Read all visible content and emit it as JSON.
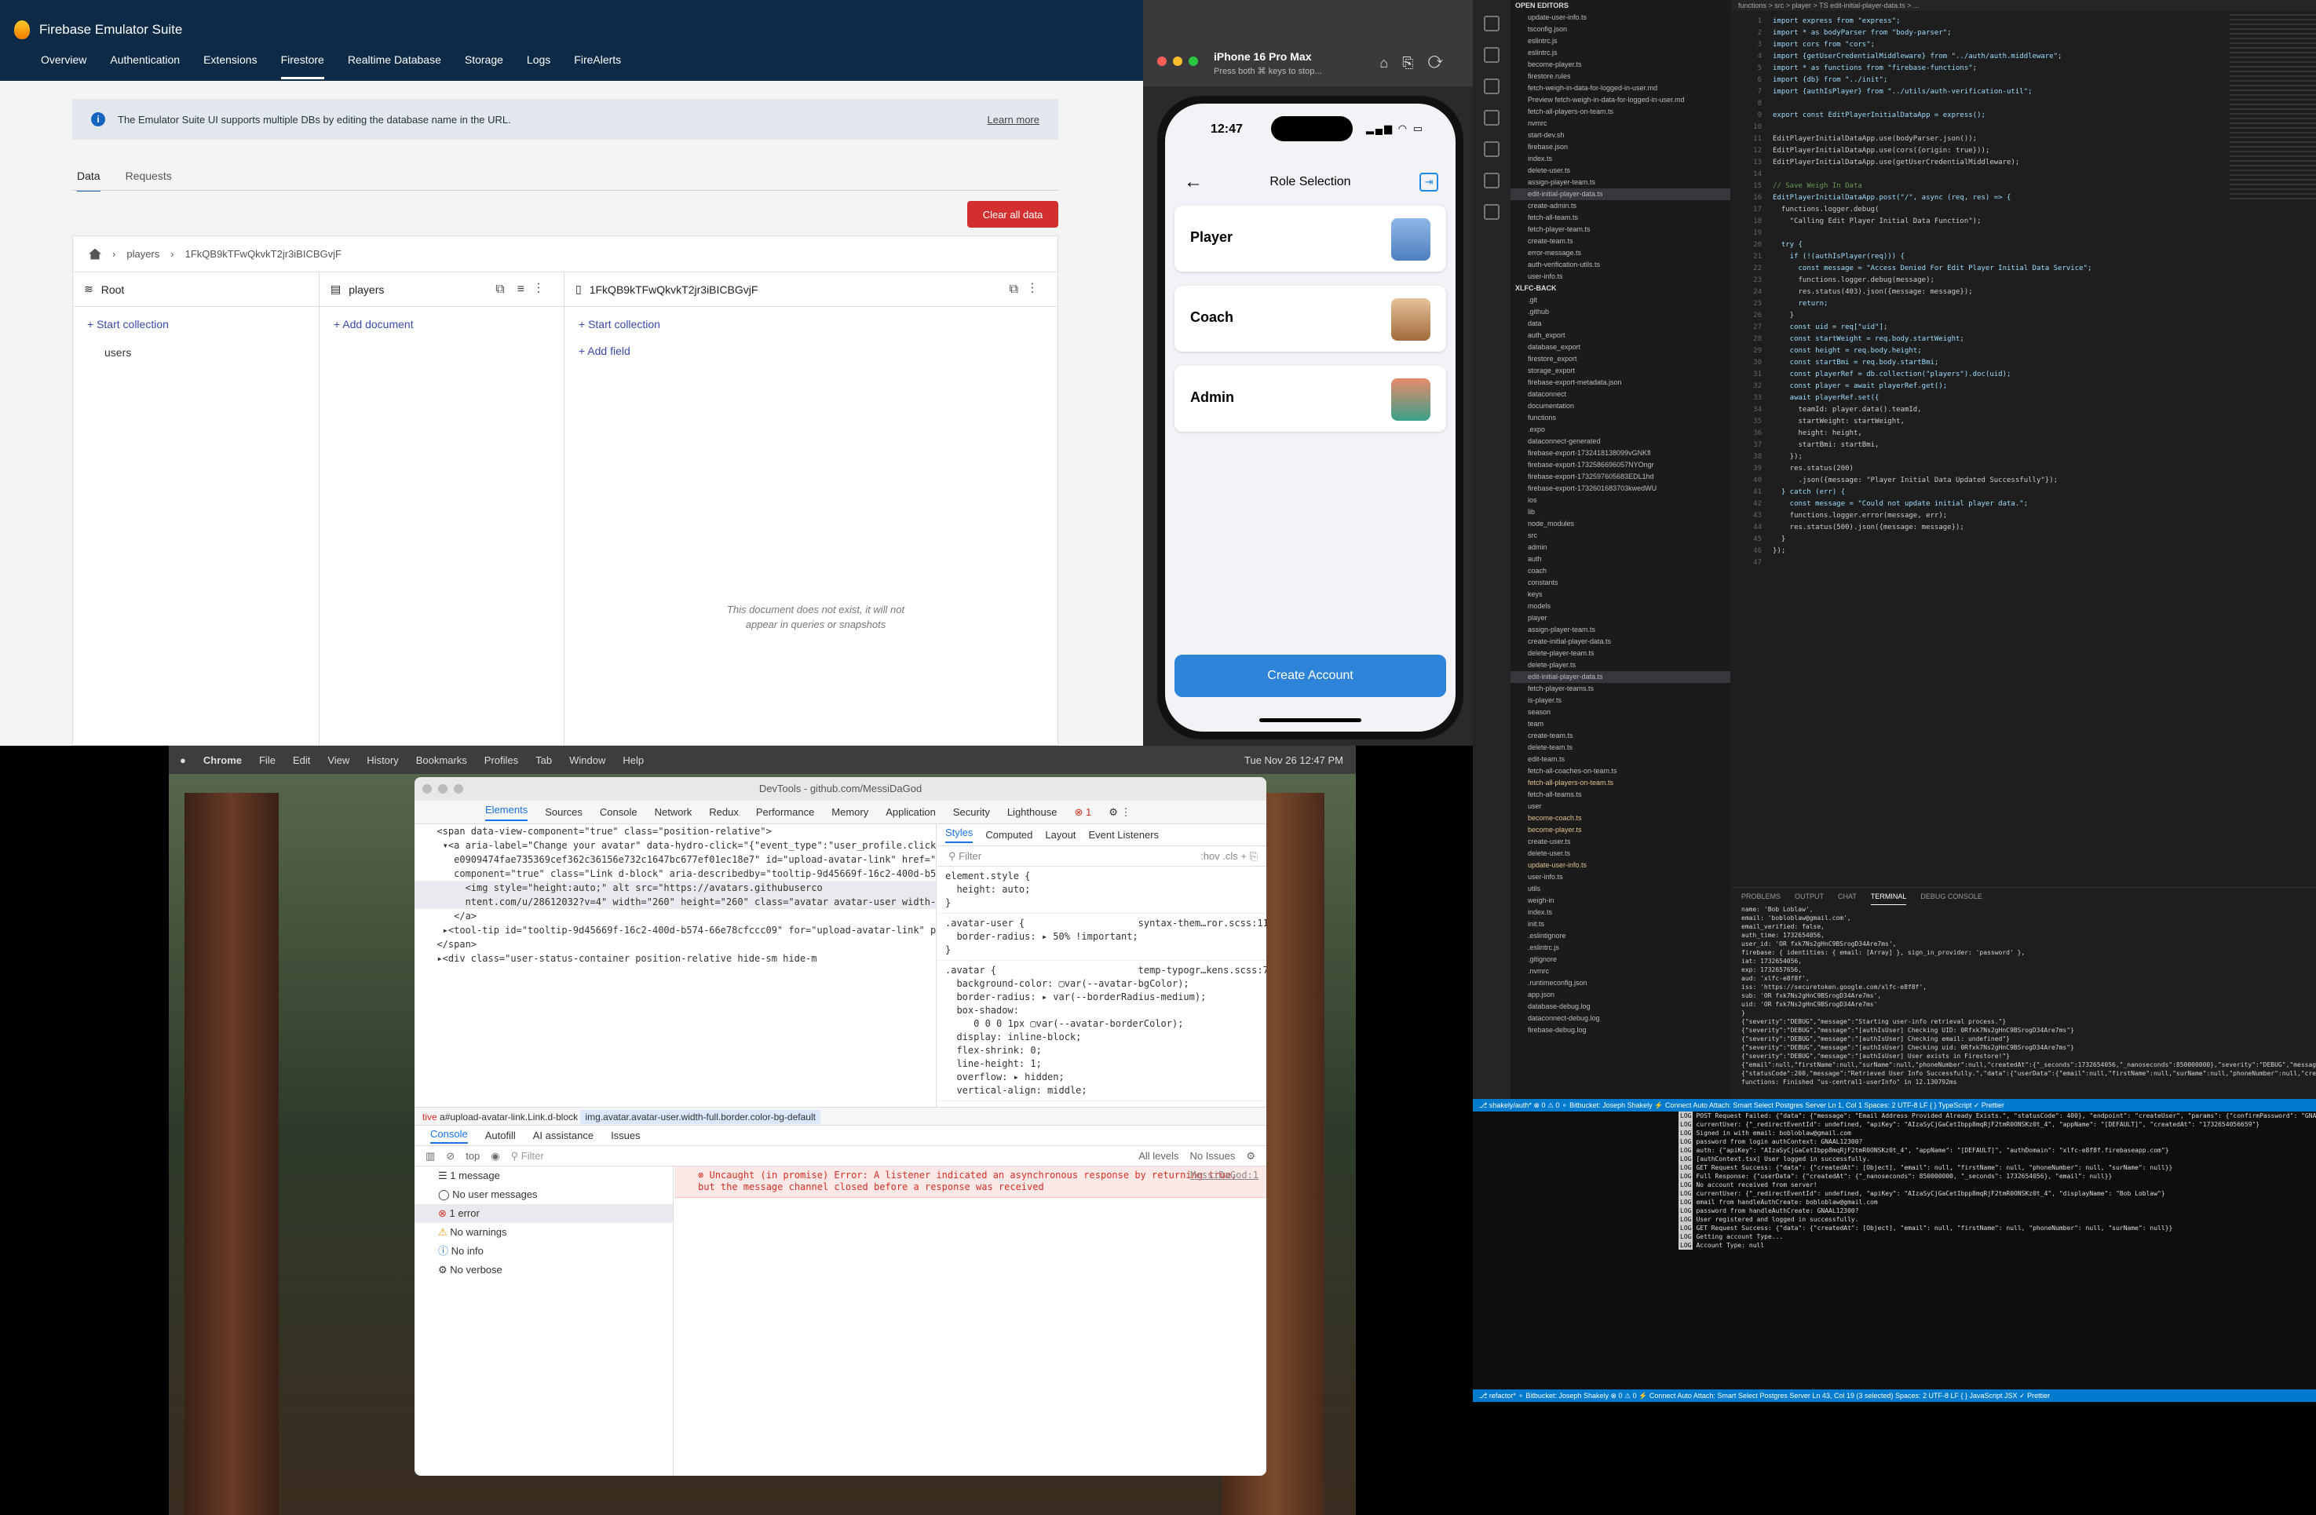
{
  "firebase": {
    "app_title": "Firebase Emulator Suite",
    "tabs": [
      "Overview",
      "Authentication",
      "Extensions",
      "Firestore",
      "Realtime Database",
      "Storage",
      "Logs",
      "FireAlerts"
    ],
    "info_text": "The Emulator Suite UI supports multiple DBs by editing the database name in the URL.",
    "learn_more": "Learn more",
    "subtabs": [
      "Data",
      "Requests"
    ],
    "clear_button": "Clear all data",
    "breadcrumb": [
      "players",
      "1FkQB9kTFwQkvkT2jr3iBICBGvjF"
    ],
    "col1_title": "Root",
    "col2_title": "players",
    "col3_title": "1FkQB9kTFwQkvkT2jr3iBICBGvjF",
    "start_collection": "Start collection",
    "add_document": "Add document",
    "add_field": "Add field",
    "root_item": "users",
    "missing_note": "This document does not exist, it will not appear in queries or snapshots"
  },
  "simulator": {
    "device": "iPhone 16 Pro Max",
    "hint": "Press both ⌘ keys to stop...",
    "time": "12:47",
    "screen_title": "Role Selection",
    "roles": [
      "Player",
      "Coach",
      "Admin"
    ],
    "create_button": "Create Account"
  },
  "vscode": {
    "tab_path": "functions > src > player > TS edit-initial-player-data.ts > ...",
    "open_editors_title": "OPEN EDITORS",
    "open_editors": [
      "update-user-info.ts",
      "tsconfig.json",
      "eslintrc.js",
      "eslintrc.js",
      "become-player.ts",
      "firestore.rules",
      "fetch-weigh-in-data-for-logged-in-user.md",
      "Preview fetch-weigh-in-data-for-logged-in-user.md",
      "fetch-all-players-on-team.ts",
      "nvmrc",
      "start-dev.sh",
      "firebase.json",
      "index.ts",
      "delete-user.ts",
      "assign-player-team.ts",
      "edit-initial-player-data.ts",
      "create-admin.ts",
      "fetch-all-team.ts",
      "fetch-player-team.ts",
      "create-team.ts",
      "error-message.ts",
      "auth-verification-utils.ts",
      "user-info.ts"
    ],
    "project_title": "XLFC-BACK",
    "tree": [
      ".git",
      ".github",
      "data",
      "auth_export",
      "database_export",
      "firestore_export",
      "storage_export",
      "firebase-export-metadata.json",
      "dataconnect",
      "documentation",
      "functions",
      ".expo",
      "dataconnect-generated",
      "firebase-export-1732418138099vGNKfl",
      "firebase-export-1732586696057NYOngr",
      "firebase-export-1732597605683EDL1hd",
      "firebase-export-1732601683703kwedWU",
      "ios",
      "lib",
      "node_modules",
      "src",
      "admin",
      "auth",
      "coach",
      "constants",
      "keys",
      "models",
      "player",
      "assign-player-team.ts",
      "create-initial-player-data.ts",
      "delete-player-team.ts",
      "delete-player.ts",
      "edit-initial-player-data.ts",
      "fetch-player-teams.ts",
      "is-player.ts",
      "season",
      "team",
      "create-team.ts",
      "delete-team.ts",
      "edit-team.ts",
      "fetch-all-coaches-on-team.ts",
      "fetch-all-players-on-team.ts",
      "fetch-all-teams.ts",
      "user",
      "become-coach.ts",
      "become-player.ts",
      "create-user.ts",
      "delete-user.ts",
      "update-user-info.ts",
      "user-info.ts",
      "utils",
      "weigh-in",
      "index.ts",
      "init.ts",
      ".eslintignore",
      ".eslintrc.js",
      ".gitignore",
      ".nvmrc",
      ".runtimeconfig.json",
      "app.json",
      "database-debug.log",
      "dataconnect-debug.log",
      "firebase-debug.log"
    ],
    "code_lines": [
      "import express from \"express\";",
      "import * as bodyParser from \"body-parser\";",
      "import cors from \"cors\";",
      "import {getUserCredentialMiddleware} from \"../auth/auth.middleware\";",
      "import * as functions from \"firebase-functions\";",
      "import {db} from \"../init\";",
      "import {authIsPlayer} from \"../utils/auth-verification-util\";",
      "",
      "export const EditPlayerInitialDataApp = express();",
      "",
      "EditPlayerInitialDataApp.use(bodyParser.json());",
      "EditPlayerInitialDataApp.use(cors({origin: true}));",
      "EditPlayerInitialDataApp.use(getUserCredentialMiddleware);",
      "",
      "// Save Weigh In Data",
      "EditPlayerInitialDataApp.post(\"/\", async (req, res) => {",
      "  functions.logger.debug(",
      "    \"Calling Edit Player Initial Data Function\");",
      "",
      "  try {",
      "    if (!(authIsPlayer(req))) {",
      "      const message = \"Access Denied For Edit Player Initial Data Service\";",
      "      functions.logger.debug(message);",
      "      res.status(403).json({message: message});",
      "      return;",
      "    }",
      "    const uid = req[\"uid\"];",
      "    const startWeight = req.body.startWeight;",
      "    const height = req.body.height;",
      "    const startBmi = req.body.startBmi;",
      "    const playerRef = db.collection(\"players\").doc(uid);",
      "    const player = await playerRef.get();",
      "    await playerRef.set({",
      "      teamId: player.data().teamId,",
      "      startWeight: startWeight,",
      "      height: height,",
      "      startBmi: startBmi,",
      "    });",
      "    res.status(200)",
      "      .json({message: \"Player Initial Data Updated Successfully\"});",
      "  } catch (err) {",
      "    const message = \"Could not update initial player data.\";",
      "    functions.logger.error(message, err);",
      "    res.status(500).json({message: message});",
      "  }",
      "});",
      ""
    ],
    "terminal_tabs": [
      "PROBLEMS",
      "OUTPUT",
      "CHAT",
      "TERMINAL",
      "DEBUG CONSOLE"
    ],
    "terminal_lines": [
      "name: 'Bob Loblaw',",
      "email: 'bobloblaw@gmail.com',",
      "email_verified: false,",
      "auth_time: 1732654056,",
      "user_id: 'OR fxk7Ns2gHnC9BSrogD34Are7ms',",
      "firebase: { identities: { email: [Array] }, sign_in_provider: 'password' },",
      "iat: 1732654056,",
      "exp: 1732657656,",
      "aud: 'xlfc-e8f8f',",
      "iss: 'https://securetoken.google.com/xlfc-e8f8f',",
      "sub: 'OR fxk7Ns2gHnC9BSrogD34Are7ms',",
      "uid: 'OR fxk7Ns2gHnC9BSrogD34Are7ms'",
      "}",
      "{\"severity\":\"DEBUG\",\"message\":\"Starting user-info retrieval process.\"}",
      "{\"severity\":\"DEBUG\",\"message\":\"[authIsUser] Checking UID: 0Rfxk7Ns2gHnC9BSrogD34Are7ms\"}",
      "{\"severity\":\"DEBUG\",\"message\":\"[authIsUser] Checking email: undefined\"}",
      "{\"severity\":\"DEBUG\",\"message\":\"[authIsUser] Checking uid: 0Rfxk7Ns2gHnC9BSrogD34Are7ms\"}",
      "{\"severity\":\"DEBUG\",\"message\":\"[authIsUser] User exists in Firestore!\"}",
      "{\"email\":null,\"firstName\":null,\"surName\":null,\"phoneNumber\":null,\"createdAt\":{\"_seconds\":1732654056,\"_nanoseconds\":850000000},\"severity\":\"DEBUG\",\"message\":\"[authIsUser] User exists in Firestore!\"}",
      "{\"statusCode\":200,\"message\":\"Retrieved User Info Successfully.\",\"data\":{\"userData\":{\"email\":null,\"firstName\":null,\"surName\":null,\"phoneNumber\":null,\"createdAt\":{\"_seconds\":1732654056,\"_nanoseconds\":850000000}}},\"severity\":\"INFO\"}",
      "functions: Finished \"us-central1-userInfo\" in 12.130792ms"
    ],
    "status_text": "⎇ shakely/auth*  ⊗ 0 ⚠ 0  ⚬ Bitbucket: Joseph Shakely  ⚡ Connect  Auto Attach: Smart  Select Postgres Server    Ln 1, Col 1  Spaces: 2  UTF-8  LF  { } TypeScript  ✓ Prettier",
    "log_lines": [
      [
        "LOG",
        "POST Request Failed: {\"data\": {\"message\": \"Email Address Provided Already Exists.\", \"statusCode\": 400}, \"endpoint\": \"createUser\", \"params\": {\"confirmPassword\": \"GNAAL12300?\"}}"
      ],
      [
        "LOG",
        "currentUser: {\"_redirectEventId\": undefined, \"apiKey\": \"AIzaSyCjGaCetIbpp8mqRjF2tmR0ONSKz0t_4\", \"appName\": \"[DEFAULT]\", \"createdAt\": \"1732654056659\"}"
      ],
      [
        "LOG",
        "Signed in with email: bobloblaw@gmail.com"
      ],
      [
        "LOG",
        "password from login authContext: GNAAL12300?"
      ],
      [
        "LOG",
        "auth: {\"apiKey\": \"AIzaSyCjGaCetIbpp8mqRjF2tmR0ONSKz0t_4\", \"appName\": \"[DEFAULT]\", \"authDomain\": \"xlfc-e8f8f.firebaseapp.com\"}"
      ],
      [
        "LOG",
        "[authContext.tsx] User logged in successfully."
      ],
      [
        "LOG",
        "GET Request Success: {\"data\": {\"createdAt\": [Object], \"email\": null, \"firstName\": null, \"phoneNumber\": null, \"surName\": null}}"
      ],
      [
        "LOG",
        "Full Response: {\"userData\": {\"createdAt\": {\"_nanoseconds\": 850000000, \"_seconds\": 1732654056}, \"email\": null}}"
      ],
      [
        "LOG",
        "No account received from server!"
      ],
      [
        "LOG",
        "currentUser: {\"_redirectEventId\": undefined, \"apiKey\": \"AIzaSyCjGaCetIbpp8mqRjF2tmR0ONSKz0t_4\", \"displayName\": \"Bob Loblaw\"}"
      ],
      [
        "LOG",
        "email from handleAuthCreate: bobloblaw@gmail.com"
      ],
      [
        "LOG",
        "password from handleAuthCreate: GNAAL12300?"
      ],
      [
        "LOG",
        "User registered and logged in successfully."
      ],
      [
        "LOG",
        "GET Request Success: {\"data\": {\"createdAt\": [Object], \"email\": null, \"firstName\": null, \"phoneNumber\": null, \"surName\": null}}"
      ],
      [
        "LOG",
        "Getting account Type..."
      ],
      [
        "LOG",
        "Account Type: null"
      ]
    ],
    "status2_text": "⎇ refactor*  ⚬ Bitbucket: Joseph Shakely  ⊗ 0 ⚠ 0  ⚡ Connect  Auto Attach: Smart  Select Postgres Server    Ln 43, Col 19 (3 selected)  Spaces: 2  UTF-8  LF  { } JavaScript JSX  ✓ Prettier"
  },
  "desktop": {
    "menubar": [
      "Chrome",
      "File",
      "Edit",
      "View",
      "History",
      "Bookmarks",
      "Profiles",
      "Tab",
      "Window",
      "Help"
    ],
    "clock": "Tue Nov 26  12:47 PM"
  },
  "devtools": {
    "title": "DevTools - github.com/MessiDaGod",
    "tabs": [
      "Elements",
      "Sources",
      "Console",
      "Network",
      "Redux",
      "Performance",
      "Memory",
      "Application",
      "Security",
      "Lighthouse"
    ],
    "error_count": "1",
    "html_lines": [
      "  <span data-view-component=\"true\" class=\"position-relative\">",
      "   ▾<a aria-label=\"Change your avatar\" data-hydro-click=\"{\"event_type\":\"user_profile.click\",\"payload\":{\"profile_user_id\":28612032,\"target\":\"EDIT_AVATAR\",\"user_id\":28612032,\"originating_url\":\"https://github.com/MessiDaGod\"}}\" data-hydro-click-hmac=\"a80483030be",
      "     e0909474fae735369cef362c36156e732c1647bc677ef01ec18e7\" id=\"upload-avatar-link\" href=\"https://github.com/account\" data-view-",
      "     component=\"true\" class=\"Link d-block\" aria-describedby=\"tooltip-9d45669f-16c2-400d-b574-66e78cfccc09\">",
      "       <img style=\"height:auto;\" alt src=\"https://avatars.githubuserco",
      "       ntent.com/u/28612032?v=4\" width=\"260\" height=\"260\" class=\"avatar avatar-user width-full border color-bg-default\"> == $0",
      "     </a>",
      "   ▸<tool-tip id=\"tooltip-9d45669f-16c2-400d-b574-66e78cfccc09\" for=\"upload-avatar-link\" popover=\"manual\" data-direction=\"s\" data-type=\"description\" data-view-component=\"true\" class=\"sr-only position-absolute\" role=\"tooltip\"> ··· </tool-tip>",
      "  </span>",
      "  ▸<div class=\"user-status-container position-relative hide-sm hide-m"
    ],
    "style_tabs": [
      "Styles",
      "Computed",
      "Layout",
      "Event Listeners"
    ],
    "filter_placeholder": "Filter",
    "style_rules": [
      "element.style {\n  height: auto;\n}",
      ".avatar-user {                    syntax-them…ror.scss:11\n  border-radius: ▸ 50% !important;\n}",
      ".avatar {                         temp-typogr…kens.scss:7\n  background-color: ▢var(--avatar-bgColor);\n  border-radius: ▸ var(--borderRadius-medium);\n  box-shadow:\n     0 0 0 1px ▢var(--avatar-borderColor);\n  display: inline-block;\n  flex-shrink: 0;\n  line-height: 1;\n  overflow: ▸ hidden;\n  vertical-align: middle;"
    ],
    "crumbs": [
      "tive",
      "a#upload-avatar-link.Link.d-block",
      "img.avatar.avatar-user.width-full.border.color-bg-default"
    ],
    "console_tabs": [
      "Console",
      "Autofill",
      "AI assistance",
      "Issues"
    ],
    "context": "top",
    "levels": "All levels",
    "issues": "No Issues",
    "side_items": [
      "1 message",
      "No user messages",
      "1 error",
      "No warnings",
      "No info",
      "No verbose"
    ],
    "error_text": "Uncaught (in promise) Error: A listener indicated an asynchronous response by returning true, but the message channel closed before a response was received",
    "error_src": "MessiDaGod:1"
  }
}
